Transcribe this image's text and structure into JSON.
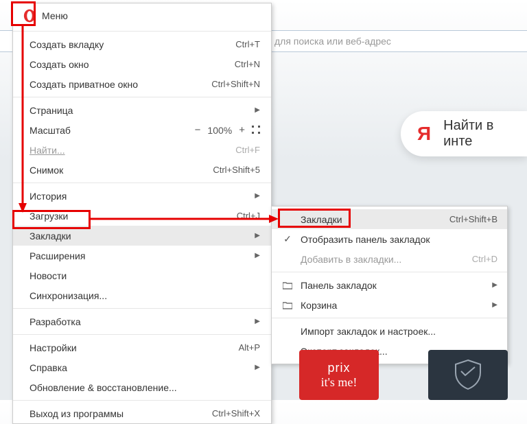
{
  "topbar": {
    "placeholder": "для поиска или веб-адрес"
  },
  "yandex": {
    "letter": "Я",
    "text": "Найти в инте"
  },
  "menu": {
    "title": "Меню",
    "items": {
      "new_tab": {
        "label": "Создать вкладку",
        "shortcut": "Ctrl+T"
      },
      "new_win": {
        "label": "Создать окно",
        "shortcut": "Ctrl+N"
      },
      "new_priv": {
        "label": "Создать приватное окно",
        "shortcut": "Ctrl+Shift+N"
      },
      "page": {
        "label": "Страница"
      },
      "zoom": {
        "label": "Масштаб",
        "value": "100%"
      },
      "find": {
        "label": "Найти...",
        "shortcut": "Ctrl+F"
      },
      "snapshot": {
        "label": "Снимок",
        "shortcut": "Ctrl+Shift+5"
      },
      "history": {
        "label": "История"
      },
      "downloads": {
        "label": "Загрузки",
        "shortcut": "Ctrl+J"
      },
      "bookmarks": {
        "label": "Закладки"
      },
      "extensions": {
        "label": "Расширения"
      },
      "news": {
        "label": "Новости"
      },
      "sync": {
        "label": "Синхронизация..."
      },
      "dev": {
        "label": "Разработка"
      },
      "settings": {
        "label": "Настройки",
        "shortcut": "Alt+P"
      },
      "help": {
        "label": "Справка"
      },
      "update": {
        "label": "Обновление & восстановление..."
      },
      "exit": {
        "label": "Выход из программы",
        "shortcut": "Ctrl+Shift+X"
      }
    }
  },
  "submenu": {
    "bookmarks": {
      "label": "Закладки",
      "shortcut": "Ctrl+Shift+B"
    },
    "show_bar": {
      "label": "Отобразить панель закладок"
    },
    "add": {
      "label": "Добавить в закладки...",
      "shortcut": "Ctrl+D"
    },
    "bar_folder": {
      "label": "Панель закладок"
    },
    "trash": {
      "label": "Корзина"
    },
    "import": {
      "label": "Импорт закладок и настроек..."
    },
    "export": {
      "label": "Экспорт закладок..."
    }
  },
  "tiles": {
    "red_l1": "prix",
    "red_l2": "it's me!"
  }
}
